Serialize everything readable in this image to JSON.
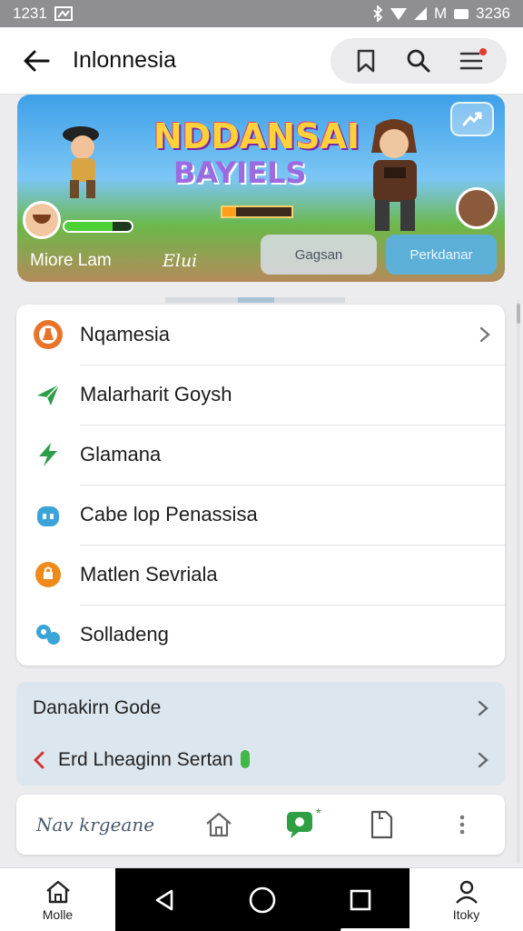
{
  "status_bar": {
    "time": "1231",
    "clock": "3236",
    "carrier_glyph": "M"
  },
  "app_bar": {
    "title": "Inlonnesia",
    "back_icon": "arrow-left-icon",
    "actions": [
      "bookmark-icon",
      "search-icon",
      "menu-icon"
    ]
  },
  "banner": {
    "title_line1": "NDDANSAI",
    "title_line2": "BAYIELS",
    "player_left": "Miore Lam",
    "player_right": "Elui",
    "secondary_button": "Gagsan",
    "primary_button": "Perkdanar",
    "hp_fraction": 0.72,
    "energy_fraction": 0.2
  },
  "menu": {
    "items": [
      {
        "label": "Nqamesia",
        "icon": "flask-icon",
        "color": "#e8742a",
        "chevron": true
      },
      {
        "label": "Malarharit Goysh",
        "icon": "paper-plane-icon",
        "color": "#2e9d4a",
        "chevron": false
      },
      {
        "label": "Glamana",
        "icon": "lightning-icon",
        "color": "#2e9d4a",
        "chevron": false
      },
      {
        "label": "Cabe lop Penassisa",
        "icon": "robot-icon",
        "color": "#3aa4d6",
        "chevron": false
      },
      {
        "label": "Matlen Sevriala",
        "icon": "shield-icon",
        "color": "#f08a1a",
        "chevron": false
      },
      {
        "label": "Solladeng",
        "icon": "people-icon",
        "color": "#3aa4d6",
        "chevron": false
      }
    ]
  },
  "secondary_card": {
    "row1_label": "Danakirn Gode",
    "row2_label": "Erd Lheaginn Sertan"
  },
  "toolbar": {
    "label": "Nav krgeane",
    "icons": [
      "home-icon",
      "chat-icon",
      "document-icon",
      "more-vertical-icon"
    ],
    "star": "*"
  },
  "bottom_nav": {
    "left_label": "Molle",
    "right_label": "Itoky"
  },
  "colors": {
    "accent": "#5cb0d8",
    "green": "#43b649",
    "status_bar": "#8f8f92"
  }
}
